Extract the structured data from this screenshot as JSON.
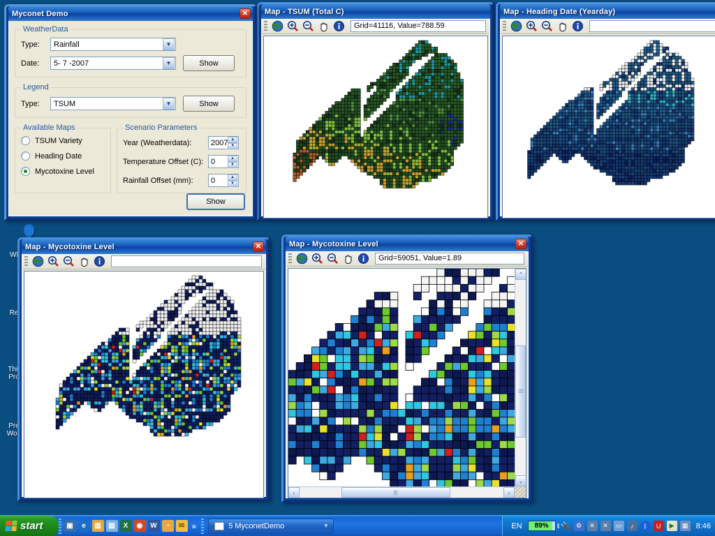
{
  "desktop": {
    "icons": [
      {
        "name": "recycle-bin",
        "label_lines": [
          "Re"
        ]
      },
      {
        "name": "third-party-program",
        "label_lines": [
          "Thir",
          "Pro"
        ]
      },
      {
        "name": "presentation-word",
        "label_lines": [
          "Pre",
          "Wop"
        ]
      },
      {
        "name": "hidden-app",
        "label_lines": [
          "Wl"
        ]
      }
    ]
  },
  "dialog": {
    "title": "Myconet Demo",
    "close_label": "✕",
    "weatherdata": {
      "legend": "WeatherData",
      "type_label": "Type:",
      "type_value": "Rainfall",
      "date_label": "Date:",
      "date_value": "5- 7 -2007",
      "show_label": "Show"
    },
    "legend_group": {
      "legend": "Legend",
      "type_label": "Type:",
      "type_value": "TSUM",
      "show_label": "Show"
    },
    "available_maps": {
      "legend": "Available Maps",
      "options": [
        {
          "label": "TSUM Variety",
          "selected": false
        },
        {
          "label": "Heading Date",
          "selected": false
        },
        {
          "label": "Mycotoxine Level",
          "selected": true
        }
      ]
    },
    "scenario": {
      "legend": "Scenario Parameters",
      "fields": [
        {
          "label": "Year (Weatherdata):",
          "value": "2007"
        },
        {
          "label": "Temperature Offset (C):",
          "value": "0"
        },
        {
          "label": "Rainfall Offset (mm):",
          "value": "0"
        }
      ]
    },
    "main_show_label": "Show"
  },
  "map_windows": [
    {
      "id": "tsum",
      "title": "Map - TSUM (Total C)",
      "status": "Grid=41116, Value=788.59",
      "close_label": "✕",
      "toolbar": [
        "globe-icon",
        "zoom-in-icon",
        "zoom-out-icon",
        "pan-hand-icon",
        "info-icon"
      ],
      "palette": {
        "base": "#2f5c32",
        "accent1": "#7fbf3f",
        "accent2": "#1b9aa8",
        "accent3": "#1a2f8a",
        "accent4": "#b35a2a"
      }
    },
    {
      "id": "heading",
      "title": "Map - Heading Date (Yearday)",
      "status": "",
      "close_label": "✕",
      "toolbar": [
        "globe-icon",
        "zoom-in-icon",
        "zoom-out-icon",
        "pan-hand-icon",
        "info-icon"
      ],
      "palette": {
        "base": "#1f4f8c",
        "accent1": "#2fb6c4",
        "accent2": "#16306f",
        "accent3": "#3a7fc1",
        "accent4": "#0f1f5e"
      }
    },
    {
      "id": "myco-overview",
      "title": "Map - Mycotoxine Level",
      "status": "",
      "close_label": "✕",
      "toolbar": [
        "globe-icon",
        "zoom-in-icon",
        "zoom-out-icon",
        "pan-hand-icon",
        "info-icon"
      ],
      "palette": {
        "base": "#121f63",
        "accent1": "#1f7fd0",
        "accent2": "#2fc8e0",
        "accent3": "#6ec82f",
        "accent4": "#d22020"
      }
    },
    {
      "id": "myco-zoom",
      "title": "Map - Mycotoxine Level",
      "status": "Grid=59051, Value=1.89",
      "close_label": "✕",
      "toolbar": [
        "globe-icon",
        "zoom-in-icon",
        "zoom-out-icon",
        "pan-hand-icon",
        "info-icon"
      ],
      "palette": {
        "base": "#111c5e",
        "accent1": "#1f7fd0",
        "accent2": "#2fc8e0",
        "accent3": "#6ec82f",
        "accent4": "#d22020",
        "accent5": "#e8a020",
        "accent6": "#ffffff"
      },
      "scrollbars": {
        "up": "⌃",
        "down": "⌄",
        "left": "‹",
        "right": "›"
      }
    }
  ],
  "taskbar": {
    "start_label": "start",
    "quicklaunch": [
      "show-desktop-icon",
      "internet-explorer-icon",
      "folder-icon",
      "document-icon",
      "excel-icon",
      "outlook-icon",
      "word-icon",
      "clock-app-icon",
      "mail-icon"
    ],
    "overflow_label": "»",
    "task_label": "5 MyconetDemo",
    "task_dropdown": "▾",
    "language": "EN",
    "battery_percent": "89%",
    "tray_icons": [
      "network-config-icon",
      "network-disconnected-icon",
      "wireless-disconnected-icon",
      "display-icon",
      "sound-icon",
      "bluetooth-icon",
      "antivirus-icon",
      "media-icon",
      "tablet-icon"
    ],
    "clock": "8:46"
  }
}
